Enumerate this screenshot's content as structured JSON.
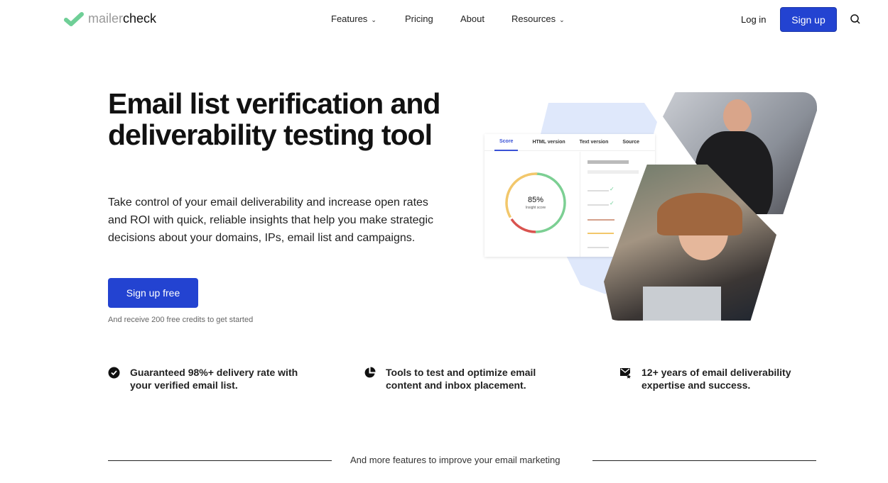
{
  "nav": {
    "logo_a": "mailer",
    "logo_b": "check",
    "items": [
      {
        "label": "Features",
        "dropdown": true
      },
      {
        "label": "Pricing"
      },
      {
        "label": "About"
      },
      {
        "label": "Resources",
        "dropdown": true
      }
    ],
    "login": "Log in",
    "signup": "Sign up",
    "search_icon": "search-icon"
  },
  "hero": {
    "title": "Email list verification and deliverability testing tool",
    "lead": "Take control of your email deliverability and increase open rates and ROI with quick, reliable insights that help you make strategic decisions about your domains, IPs, email list and campaigns.",
    "cta": "Sign up free",
    "note": "And receive 200 free credits to get started"
  },
  "mock": {
    "tabs": [
      "Score",
      "HTML version",
      "Text version",
      "Source"
    ],
    "score": "85%",
    "score_label": "Insight score"
  },
  "features": [
    {
      "icon": "check-circle-icon",
      "text": "Guaranteed 98%+ delivery rate with your verified email list."
    },
    {
      "icon": "pie-chart-icon",
      "text": "Tools to test and optimize email content and inbox placement."
    },
    {
      "icon": "mail-star-icon",
      "text": "12+ years of email deliverability expertise and success."
    }
  ],
  "more": "And more features to improve your email marketing",
  "colors": {
    "accent": "#2343d1",
    "logo_green": "#6fcf97"
  }
}
